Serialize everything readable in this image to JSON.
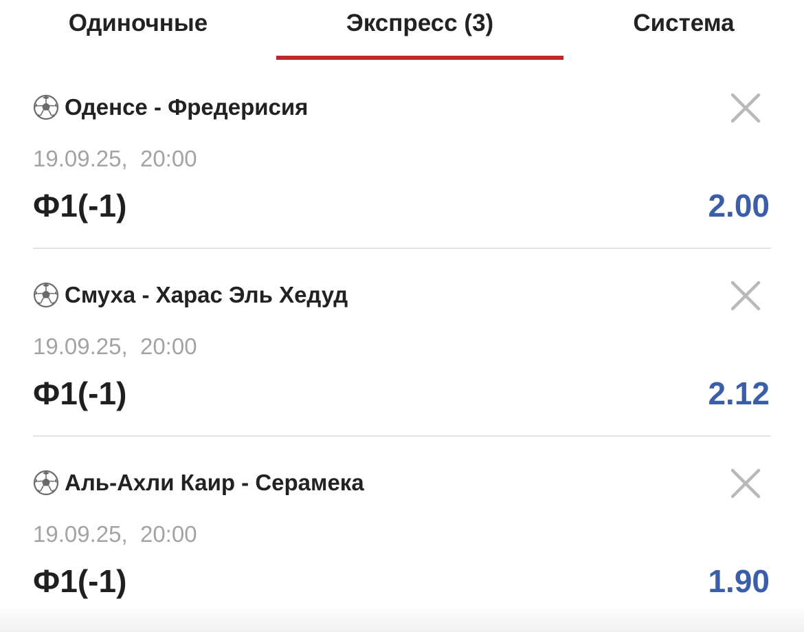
{
  "tabs": [
    {
      "label": "Одиночные",
      "active": false
    },
    {
      "label": "Экспресс (3)",
      "active": true
    },
    {
      "label": "Система",
      "active": false
    }
  ],
  "colors": {
    "accent_underline": "#c0272d",
    "odds": "#3a5ea8",
    "date": "#a3a3a3"
  },
  "bets": [
    {
      "icon": "soccer-ball-icon",
      "match": "Оденсе - Фредерисия",
      "datetime": "19.09.25,  20:00",
      "market": "Ф1(-1)",
      "odds": "2.00"
    },
    {
      "icon": "soccer-ball-icon",
      "match": "Смуха - Харас Эль Хедуд",
      "datetime": "19.09.25,  20:00",
      "market": "Ф1(-1)",
      "odds": "2.12"
    },
    {
      "icon": "soccer-ball-icon",
      "match": "Аль-Ахли Каир - Серамека",
      "datetime": "19.09.25,  20:00",
      "market": "Ф1(-1)",
      "odds": "1.90"
    }
  ]
}
